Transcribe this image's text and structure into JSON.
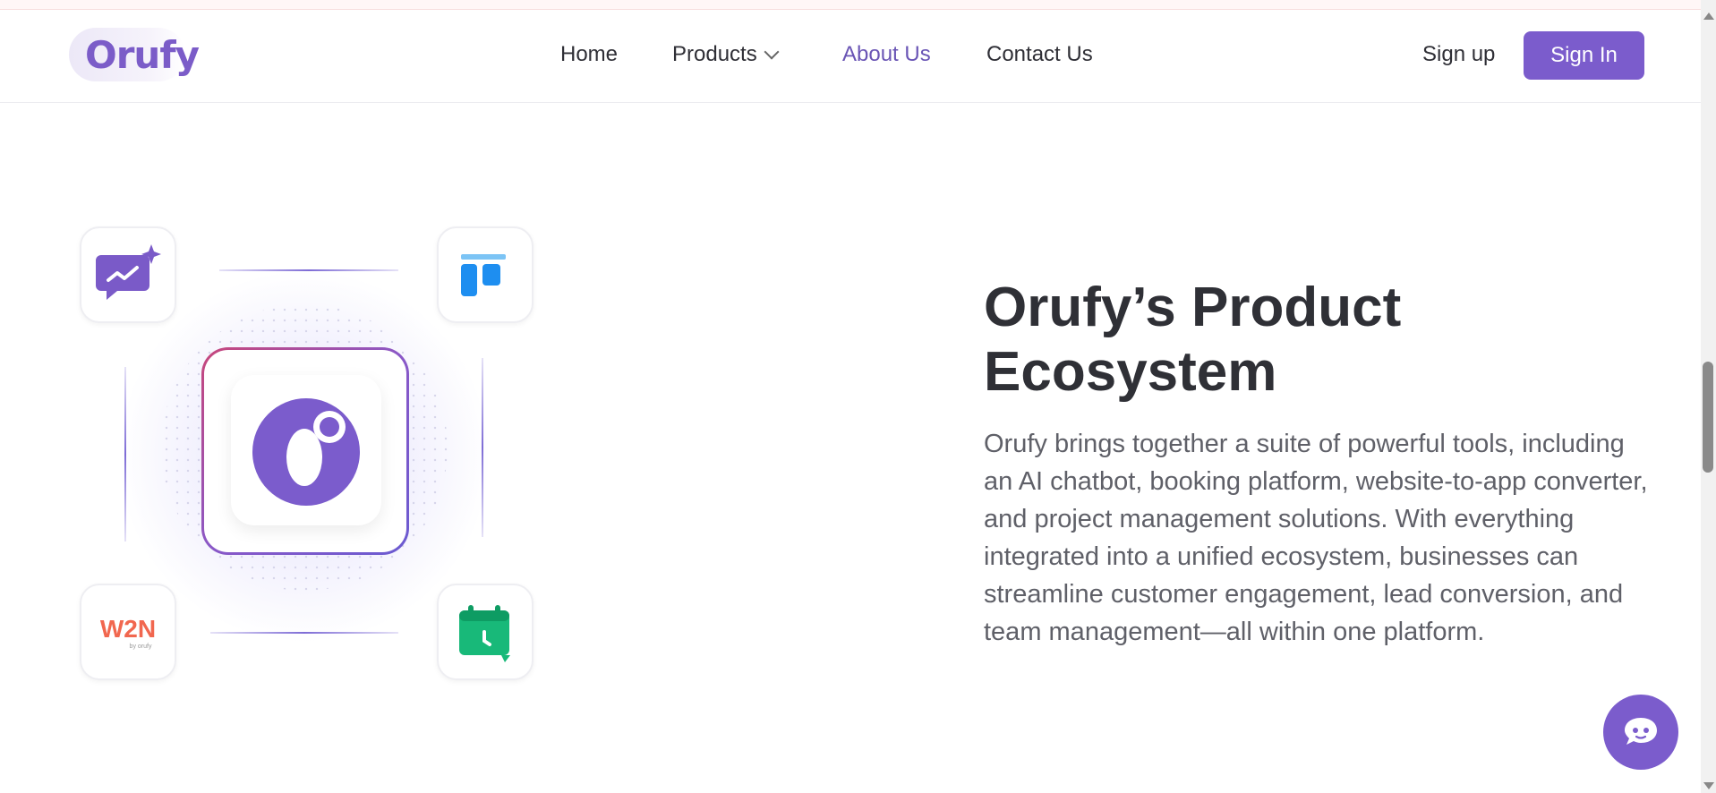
{
  "brand": {
    "logo_text": "Orufy",
    "accent": "#7b5ccc",
    "link_active": "#6a55b5"
  },
  "nav": {
    "items": [
      {
        "label": "Home"
      },
      {
        "label": "Products"
      },
      {
        "label": "About Us"
      },
      {
        "label": "Contact Us"
      }
    ],
    "active": "About Us"
  },
  "auth": {
    "signup_label": "Sign up",
    "signin_label": "Sign In"
  },
  "hero": {
    "title_line1": "Orufy’s Product",
    "title_line2": "Ecosystem",
    "description": "Orufy brings together a suite of powerful tools, including an AI chatbot, booking platform, website-to-app converter, and project management solutions. With everything integrated into a unified ecosystem, businesses can streamline customer engagement, lead conversion, and team management—all within one platform."
  },
  "icons": {
    "tile_top_left": "ai-chatbot-icon",
    "tile_top_right": "project-board-icon",
    "tile_bottom_left": "w2n-logo-icon",
    "tile_bottom_right": "booking-calendar-icon",
    "center": "orufy-logo-icon",
    "chat": "chat-bubble-icon"
  },
  "w2n_logo": {
    "text": "W2N",
    "subtext": "by orufy",
    "color": "#f1674f"
  }
}
